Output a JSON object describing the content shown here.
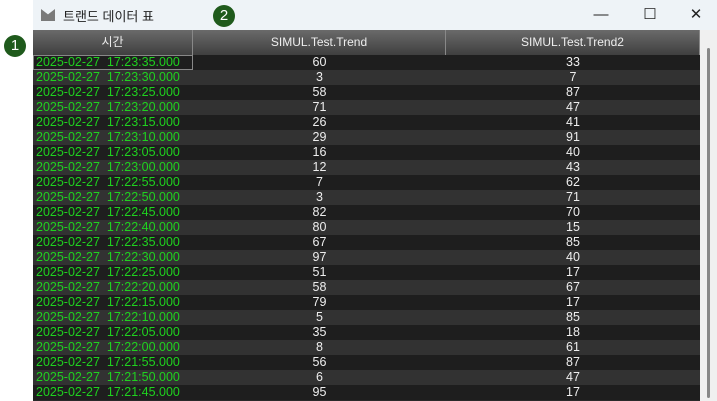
{
  "badges": [
    "1",
    "2"
  ],
  "window": {
    "title": "트랜드 데이터 표",
    "minimize": "—",
    "maximize": "☐",
    "close": "✕"
  },
  "columns": [
    "시간",
    "SIMUL.Test.Trend",
    "SIMUL.Test.Trend2"
  ],
  "rows": [
    [
      "2025-02-27  17:23:35.000",
      "60",
      "33"
    ],
    [
      "2025-02-27  17:23:30.000",
      "3",
      "7"
    ],
    [
      "2025-02-27  17:23:25.000",
      "58",
      "87"
    ],
    [
      "2025-02-27  17:23:20.000",
      "71",
      "47"
    ],
    [
      "2025-02-27  17:23:15.000",
      "26",
      "41"
    ],
    [
      "2025-02-27  17:23:10.000",
      "29",
      "91"
    ],
    [
      "2025-02-27  17:23:05.000",
      "16",
      "40"
    ],
    [
      "2025-02-27  17:23:00.000",
      "12",
      "43"
    ],
    [
      "2025-02-27  17:22:55.000",
      "7",
      "62"
    ],
    [
      "2025-02-27  17:22:50.000",
      "3",
      "71"
    ],
    [
      "2025-02-27  17:22:45.000",
      "82",
      "70"
    ],
    [
      "2025-02-27  17:22:40.000",
      "80",
      "15"
    ],
    [
      "2025-02-27  17:22:35.000",
      "67",
      "85"
    ],
    [
      "2025-02-27  17:22:30.000",
      "97",
      "40"
    ],
    [
      "2025-02-27  17:22:25.000",
      "51",
      "17"
    ],
    [
      "2025-02-27  17:22:20.000",
      "58",
      "67"
    ],
    [
      "2025-02-27  17:22:15.000",
      "79",
      "17"
    ],
    [
      "2025-02-27  17:22:10.000",
      "5",
      "85"
    ],
    [
      "2025-02-27  17:22:05.000",
      "35",
      "18"
    ],
    [
      "2025-02-27  17:22:00.000",
      "8",
      "61"
    ],
    [
      "2025-02-27  17:21:55.000",
      "56",
      "87"
    ],
    [
      "2025-02-27  17:21:50.000",
      "6",
      "47"
    ],
    [
      "2025-02-27  17:21:45.000",
      "95",
      "17"
    ]
  ]
}
